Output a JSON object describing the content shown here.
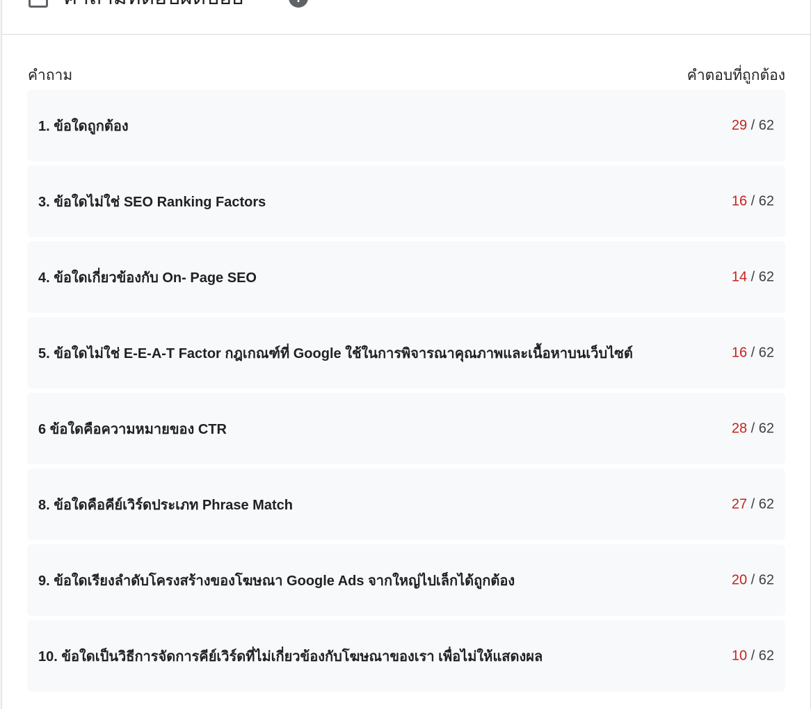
{
  "header": {
    "title": "คำถามที่ตอบผิดบ่อย"
  },
  "columns": {
    "question": "คำถาม",
    "answer": "คำตอบที่ถูกต้อง"
  },
  "questions": [
    {
      "text": "1. ข้อใดถูกต้อง",
      "correct": "29",
      "total": "62"
    },
    {
      "text": "3. ข้อใดไม่ใช่ SEO Ranking Factors",
      "correct": "16",
      "total": "62"
    },
    {
      "text": "4. ข้อใดเกี่ยวข้องกับ On- Page SEO",
      "correct": "14",
      "total": "62"
    },
    {
      "text": "5. ข้อใดไม่ใช่ E-E-A-T Factor กฎเกณฑ์ที่ Google ใช้ในการพิจารณาคุณภาพและเนื้อหาบนเว็บไซต์",
      "correct": "16",
      "total": "62"
    },
    {
      "text": "6 ข้อใดคือความหมายของ CTR",
      "correct": "28",
      "total": "62"
    },
    {
      "text": "8. ข้อใดคือคีย์เวิร์ดประเภท Phrase Match",
      "correct": "27",
      "total": "62"
    },
    {
      "text": "9. ข้อใดเรียงลำดับโครงสร้างของโฆษณา Google Ads จากใหญ่ไปเล็กได้ถูกต้อง",
      "correct": "20",
      "total": "62"
    },
    {
      "text": "10. ข้อใดเป็นวิธีการจัดการคีย์เวิร์ดที่ไม่เกี่ยวข้องกับโฆษณาของเรา เพื่อไม่ให้แสดงผล",
      "correct": "10",
      "total": "62"
    }
  ],
  "colors": {
    "correct_count": "#c5221f",
    "row_bg": "#f8f9fa"
  }
}
